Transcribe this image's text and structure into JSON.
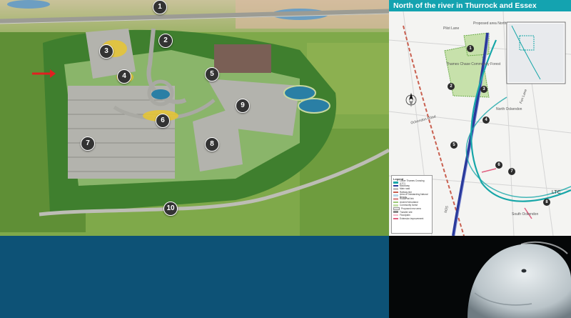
{
  "aerial": {
    "markers": [
      "1",
      "2",
      "3",
      "4",
      "5",
      "6",
      "7",
      "8",
      "9",
      "10"
    ]
  },
  "map": {
    "title": "North of the river in Thurrock and Essex",
    "markers": [
      "1",
      "2",
      "3",
      "4",
      "5",
      "6",
      "7",
      "8"
    ],
    "labels": {
      "pilot_lane": "Pilot Lane",
      "proposed_area": "Proposed area North",
      "community_park": "Thames Chase Community Forest",
      "north_ockendon": "North Ockendon",
      "ockendon_road": "Ockendon Road",
      "south_ockendon": "South Ockendon",
      "ltc": "LTC",
      "m25": "M25",
      "fen_lane": "Fen Lane"
    },
    "legend": {
      "title": "Legend",
      "items": [
        "Lower Thames Crossing (LTC)",
        "Motorway",
        "Main road",
        "Railway line",
        "Area of Outstanding Natural Beauty",
        "Road/Rail link",
        "Ancient Woodland",
        "Community forest",
        "Proposed new area",
        "Transfer site",
        "Floodplain",
        "Extension improvement"
      ]
    }
  },
  "colors": {
    "panel_blue": "#0d5276",
    "title_bar": "#14a3b0",
    "ltc_teal": "#16a6a8",
    "m25_blue": "#2a3a9c"
  }
}
